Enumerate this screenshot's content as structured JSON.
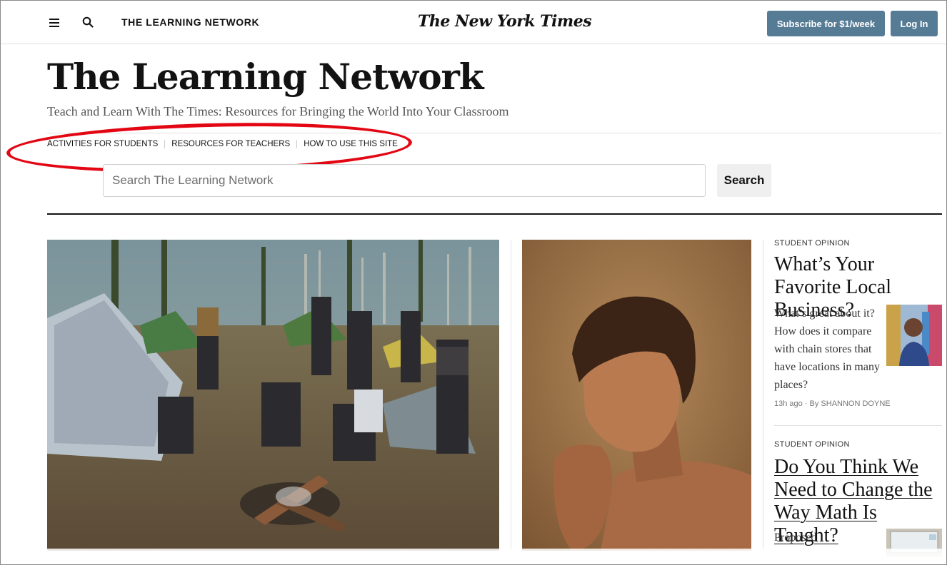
{
  "header": {
    "section_name": "THE LEARNING NETWORK",
    "logo_text": "The New York Times",
    "subscribe_label": "Subscribe for $1/week",
    "login_label": "Log In"
  },
  "masthead": {
    "title": "The Learning Network",
    "tagline": "Teach and Learn With The Times: Resources for Bringing the World Into Your Classroom"
  },
  "subnav": {
    "items": [
      {
        "label": "ACTIVITIES FOR STUDENTS"
      },
      {
        "label": "RESOURCES FOR TEACHERS"
      },
      {
        "label": "HOW TO USE THIS SITE"
      }
    ]
  },
  "search": {
    "placeholder": "Search The Learning Network",
    "button_label": "Search"
  },
  "stories": [
    {
      "kicker": "STUDENT OPINION",
      "headline": "What’s Your Favorite Local Business?",
      "summary": "What’s great about it? How does it compare with chain stores that have locations in many places?",
      "byline": "13h ago · By SHANNON DOYNE"
    },
    {
      "kicker": "STUDENT OPINION",
      "headline": "Do You Think We Need to Change the Way Math Is Taught?",
      "summary": "Proposed"
    }
  ],
  "colors": {
    "button_blue": "#567b95",
    "annotation_red": "#e30613"
  },
  "icons": [
    "menu-icon",
    "search-icon"
  ]
}
